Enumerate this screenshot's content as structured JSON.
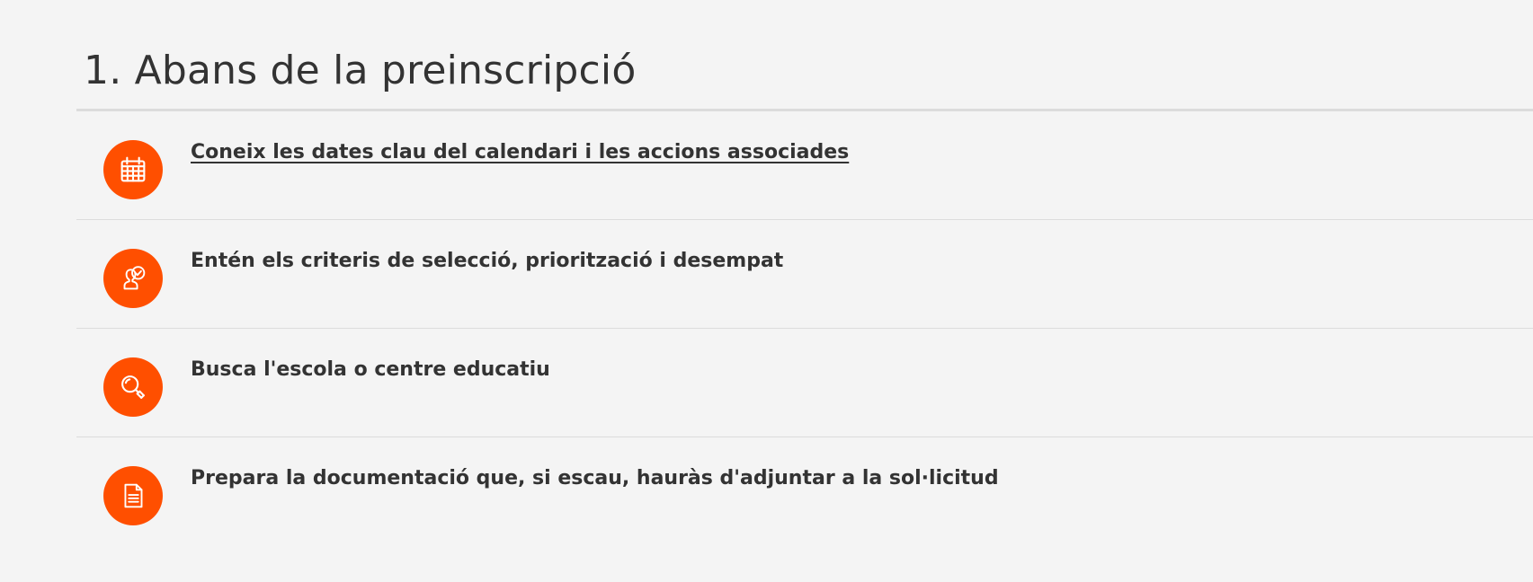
{
  "section": {
    "title": "1. Abans de la preinscripció",
    "accent_color": "#ff4f00",
    "steps": [
      {
        "icon": "calendar-icon",
        "label": "Coneix les dates clau del calendari i les accions associades",
        "is_link": true
      },
      {
        "icon": "user-check-icon",
        "label": "Entén els criteris de selecció, priorització i desempat",
        "is_link": false
      },
      {
        "icon": "search-icon",
        "label": "Busca l'escola o centre educatiu",
        "is_link": false
      },
      {
        "icon": "document-icon",
        "label": "Prepara la documentació que, si escau, hauràs d'adjuntar a la sol·licitud",
        "is_link": false
      }
    ]
  }
}
